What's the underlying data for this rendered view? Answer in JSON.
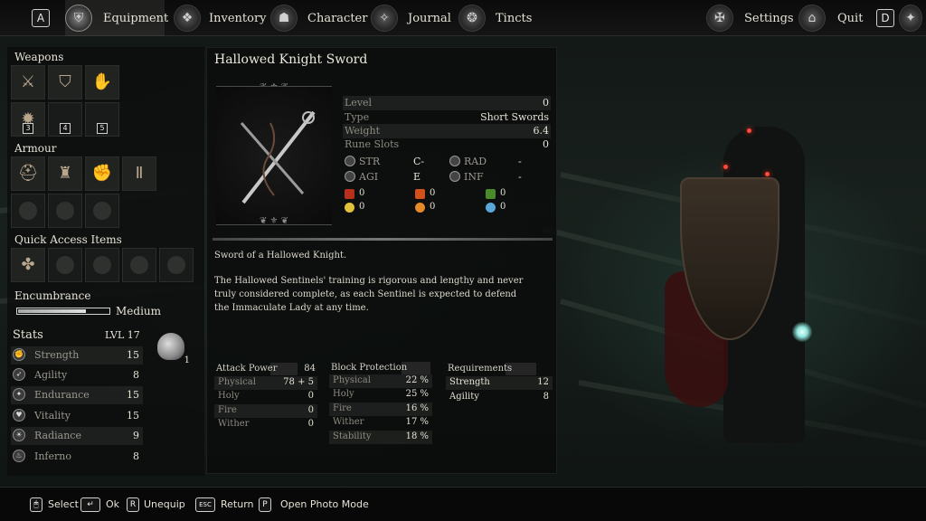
{
  "topbar": {
    "left_key": "A",
    "right_key": "D",
    "tabs": [
      {
        "label": "Equipment",
        "icon": "helmet-icon"
      },
      {
        "label": "Inventory",
        "icon": "bag-icon"
      },
      {
        "label": "Character",
        "icon": "character-icon"
      },
      {
        "label": "Journal",
        "icon": "journal-icon"
      },
      {
        "label": "Tincts",
        "icon": "tincts-icon"
      }
    ],
    "settings_label": "Settings",
    "quit_label": "Quit"
  },
  "left": {
    "weapons_title": "Weapons",
    "weapon_slot_numbers": [
      "3",
      "4",
      "5"
    ],
    "armour_title": "Armour",
    "quick_title": "Quick Access Items",
    "encumbrance_title": "Encumbrance",
    "encumbrance_level": "Medium",
    "encumbrance_fill": 0.74,
    "stats_title": "Stats",
    "level": "LVL 17",
    "stats": [
      {
        "label": "Strength",
        "value": "15"
      },
      {
        "label": "Agility",
        "value": "8"
      },
      {
        "label": "Endurance",
        "value": "15"
      },
      {
        "label": "Vitality",
        "value": "15"
      },
      {
        "label": "Radiance",
        "value": "9"
      },
      {
        "label": "Inferno",
        "value": "8"
      }
    ],
    "souls_count": "1"
  },
  "item": {
    "name": "Hallowed Knight Sword",
    "info": [
      {
        "label": "Level",
        "value": "0"
      },
      {
        "label": "Type",
        "value": "Short Swords"
      },
      {
        "label": "Weight",
        "value": "6.4"
      },
      {
        "label": "Rune Slots",
        "value": "0"
      }
    ],
    "scaling": [
      {
        "label": "STR",
        "value": "C-"
      },
      {
        "label": "RAD",
        "value": "-"
      },
      {
        "label": "AGI",
        "value": "E"
      },
      {
        "label": "INF",
        "value": "-"
      }
    ],
    "status_effects": [
      {
        "value": "0",
        "color": "#b8301c"
      },
      {
        "value": "0",
        "color": "#d2501a"
      },
      {
        "value": "0",
        "color": "#4a8a2a"
      },
      {
        "value": "0",
        "color": "#e2c23a"
      },
      {
        "value": "0",
        "color": "#e58a2a"
      },
      {
        "value": "0",
        "color": "#5aa6d8"
      }
    ],
    "description_short": "Sword of a Hallowed Knight.",
    "description_long": "The Hallowed Sentinels' training is rigorous and lengthy and never truly considered complete, as each Sentinel is expected to defend the Immaculate Lady at any time.",
    "attack": {
      "title": "Attack Power",
      "total": "84",
      "rows": [
        {
          "label": "Physical",
          "value": "78 + 5"
        },
        {
          "label": "Holy",
          "value": "0"
        },
        {
          "label": "Fire",
          "value": "0"
        },
        {
          "label": "Wither",
          "value": "0"
        }
      ]
    },
    "block": {
      "title": "Block Protection",
      "rows": [
        {
          "label": "Physical",
          "value": "22 %"
        },
        {
          "label": "Holy",
          "value": "25 %"
        },
        {
          "label": "Fire",
          "value": "16 %"
        },
        {
          "label": "Wither",
          "value": "17 %"
        },
        {
          "label": "Stability",
          "value": "18 %"
        }
      ]
    },
    "requirements": {
      "title": "Requirements",
      "rows": [
        {
          "label": "Strength",
          "value": "12"
        },
        {
          "label": "Agility",
          "value": "8"
        }
      ]
    }
  },
  "hints": [
    {
      "key": "🖱",
      "label": "Select"
    },
    {
      "key": "↵",
      "label": "Ok"
    },
    {
      "key": "R",
      "label": "Unequip"
    },
    {
      "key": "ESC",
      "label": "Return"
    },
    {
      "key": "P",
      "label": "Open Photo Mode"
    }
  ]
}
